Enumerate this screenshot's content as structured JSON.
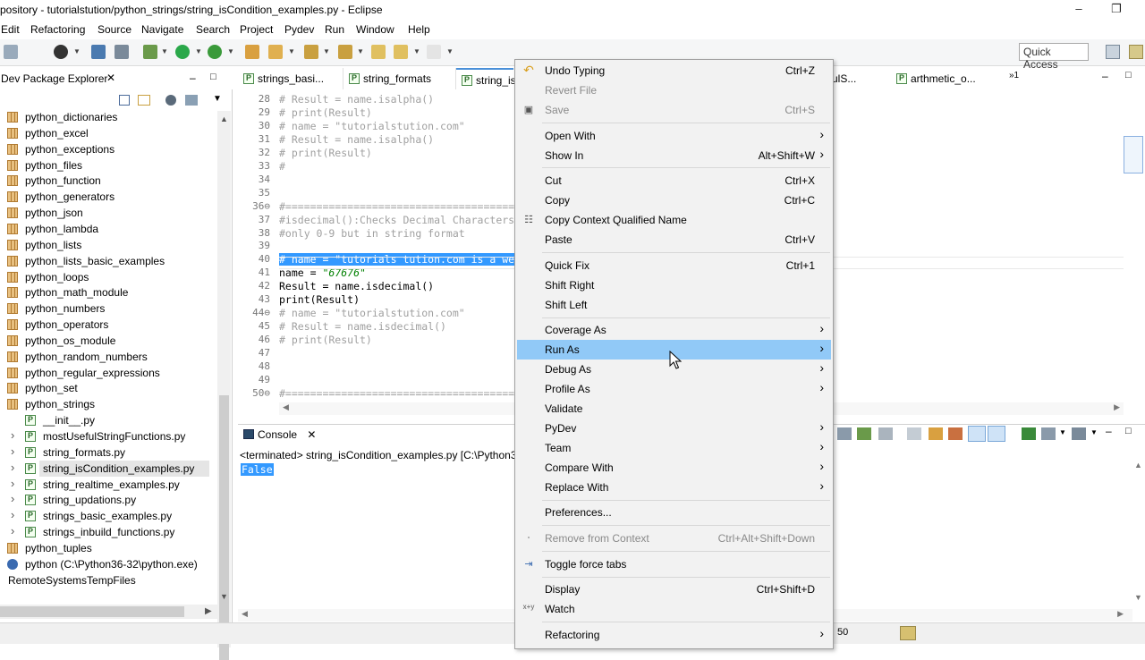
{
  "window": {
    "title": "pository - tutorialstution/python_strings/string_isCondition_examples.py - Eclipse"
  },
  "menubar": [
    "Edit",
    "Refactoring",
    "Source",
    "Navigate",
    "Search",
    "Project",
    "Pydev",
    "Run",
    "Window",
    "Help"
  ],
  "toolbar": {
    "quick_access": "Quick Access"
  },
  "package_explorer": {
    "title": "Dev Package Explorer",
    "items": [
      {
        "label": "python_dictionaries",
        "type": "pkg"
      },
      {
        "label": "python_excel",
        "type": "pkg"
      },
      {
        "label": "python_exceptions",
        "type": "pkg"
      },
      {
        "label": "python_files",
        "type": "pkg"
      },
      {
        "label": "python_function",
        "type": "pkg"
      },
      {
        "label": "python_generators",
        "type": "pkg"
      },
      {
        "label": "python_json",
        "type": "pkg"
      },
      {
        "label": "python_lambda",
        "type": "pkg"
      },
      {
        "label": "python_lists",
        "type": "pkg"
      },
      {
        "label": "python_lists_basic_examples",
        "type": "pkg"
      },
      {
        "label": "python_loops",
        "type": "pkg"
      },
      {
        "label": "python_math_module",
        "type": "pkg"
      },
      {
        "label": "python_numbers",
        "type": "pkg"
      },
      {
        "label": "python_operators",
        "type": "pkg"
      },
      {
        "label": "python_os_module",
        "type": "pkg"
      },
      {
        "label": "python_random_numbers",
        "type": "pkg"
      },
      {
        "label": "python_regular_expressions",
        "type": "pkg"
      },
      {
        "label": "python_set",
        "type": "pkg"
      },
      {
        "label": "python_strings",
        "type": "pkg"
      },
      {
        "label": "__init__.py",
        "type": "file"
      },
      {
        "label": "mostUsefulStringFunctions.py",
        "type": "file"
      },
      {
        "label": "string_formats.py",
        "type": "file"
      },
      {
        "label": "string_isCondition_examples.py",
        "type": "file"
      },
      {
        "label": "string_realtime_examples.py",
        "type": "file"
      },
      {
        "label": "string_updations.py",
        "type": "file"
      },
      {
        "label": "strings_basic_examples.py",
        "type": "file"
      },
      {
        "label": "strings_inbuild_functions.py",
        "type": "file"
      },
      {
        "label": "python_tuples",
        "type": "pkg"
      },
      {
        "label": "python  (C:\\Python36-32\\python.exe)",
        "type": "interp"
      },
      {
        "label": "RemoteSystemsTempFiles",
        "type": "proj"
      }
    ]
  },
  "editor": {
    "tabs": [
      "strings_basi...",
      "string_formats",
      "string_is",
      "efulS...",
      "arthmetic_o..."
    ],
    "overflow": "»1",
    "lines": [
      {
        "n": "28",
        "text": "# Result = name.isalpha()",
        "kind": "cm"
      },
      {
        "n": "29",
        "text": "# print(Result)",
        "kind": "cm"
      },
      {
        "n": "30",
        "text": "# name = \"tutorialstution.com\"",
        "kind": "cm"
      },
      {
        "n": "31",
        "text": "# Result = name.isalpha()",
        "kind": "cm"
      },
      {
        "n": "32",
        "text": "# print(Result)",
        "kind": "cm"
      },
      {
        "n": "33",
        "text": "#",
        "kind": "cm"
      },
      {
        "n": "34",
        "text": "",
        "kind": "cm"
      },
      {
        "n": "35",
        "text": "",
        "kind": "cm"
      },
      {
        "n": "36⊖",
        "text": "#==========================================",
        "kind": "cm"
      },
      {
        "n": "37",
        "text": "#isdecimal():Checks Decimal Characters",
        "kind": "cm"
      },
      {
        "n": "38",
        "text": "#only 0-9 but in string format",
        "kind": "cm"
      },
      {
        "n": "39",
        "text": "",
        "kind": "cm"
      },
      {
        "n": "40",
        "text": "# name = \"tutorials tution.com is a we",
        "kind": "hl"
      },
      {
        "n": "41",
        "text": "name = ",
        "str": "\"67676\"",
        "kind": "code"
      },
      {
        "n": "42",
        "text": "Result = name.isdecimal()",
        "kind": "code"
      },
      {
        "n": "43",
        "text": "print(Result)",
        "kind": "code"
      },
      {
        "n": "44⊖",
        "text": "# name = \"tutorialstution.com\"",
        "kind": "cm"
      },
      {
        "n": "45",
        "text": "# Result = name.isdecimal()",
        "kind": "cm"
      },
      {
        "n": "46",
        "text": "# print(Result)",
        "kind": "cm"
      },
      {
        "n": "47",
        "text": "",
        "kind": "cm"
      },
      {
        "n": "48",
        "text": "",
        "kind": "cm"
      },
      {
        "n": "49",
        "text": "",
        "kind": "cm"
      },
      {
        "n": "50⊖",
        "text": "#==========================================",
        "kind": "cm"
      }
    ]
  },
  "console": {
    "title": "Console",
    "terminated": "<terminated> string_isCondition_examples.py [C:\\Python3",
    "output": "False"
  },
  "status": {
    "line": "50"
  },
  "context_menu": {
    "items": [
      {
        "label": "Undo Typing",
        "shortcut": "Ctrl+Z",
        "icon": "undo-icon"
      },
      {
        "label": "Revert File",
        "disabled": true
      },
      {
        "label": "Save",
        "shortcut": "Ctrl+S",
        "disabled": true,
        "icon": "save-icon"
      },
      {
        "sep": true
      },
      {
        "label": "Open With",
        "submenu": true
      },
      {
        "label": "Show In",
        "shortcut": "Alt+Shift+W",
        "submenu": true
      },
      {
        "sep": true
      },
      {
        "label": "Cut",
        "shortcut": "Ctrl+X"
      },
      {
        "label": "Copy",
        "shortcut": "Ctrl+C"
      },
      {
        "label": "Copy Context Qualified Name",
        "icon": "copy-qualified-icon"
      },
      {
        "label": "Paste",
        "shortcut": "Ctrl+V"
      },
      {
        "sep": true
      },
      {
        "label": "Quick Fix",
        "shortcut": "Ctrl+1"
      },
      {
        "label": "Shift Right"
      },
      {
        "label": "Shift Left"
      },
      {
        "sep": true
      },
      {
        "label": "Coverage As",
        "submenu": true
      },
      {
        "label": "Run As",
        "submenu": true,
        "highlighted": true
      },
      {
        "label": "Debug As",
        "submenu": true
      },
      {
        "label": "Profile As",
        "submenu": true
      },
      {
        "label": "Validate"
      },
      {
        "label": "PyDev",
        "submenu": true
      },
      {
        "label": "Team",
        "submenu": true
      },
      {
        "label": "Compare With",
        "submenu": true
      },
      {
        "label": "Replace With",
        "submenu": true
      },
      {
        "sep": true
      },
      {
        "label": "Preferences..."
      },
      {
        "sep": true
      },
      {
        "label": "Remove from Context",
        "shortcut": "Ctrl+Alt+Shift+Down",
        "disabled": true,
        "icon": "remove-context-icon"
      },
      {
        "sep": true
      },
      {
        "label": "Toggle force tabs",
        "icon": "toggle-tabs-icon"
      },
      {
        "sep": true
      },
      {
        "label": "Display",
        "shortcut": "Ctrl+Shift+D"
      },
      {
        "label": "Watch",
        "icon": "watch-icon"
      },
      {
        "sep": true
      },
      {
        "label": "Refactoring",
        "submenu": true
      }
    ]
  },
  "colors": {
    "selection": "#3399ff",
    "menu_highlight": "#91c9f7",
    "menu_bg": "#f2f2f2"
  }
}
